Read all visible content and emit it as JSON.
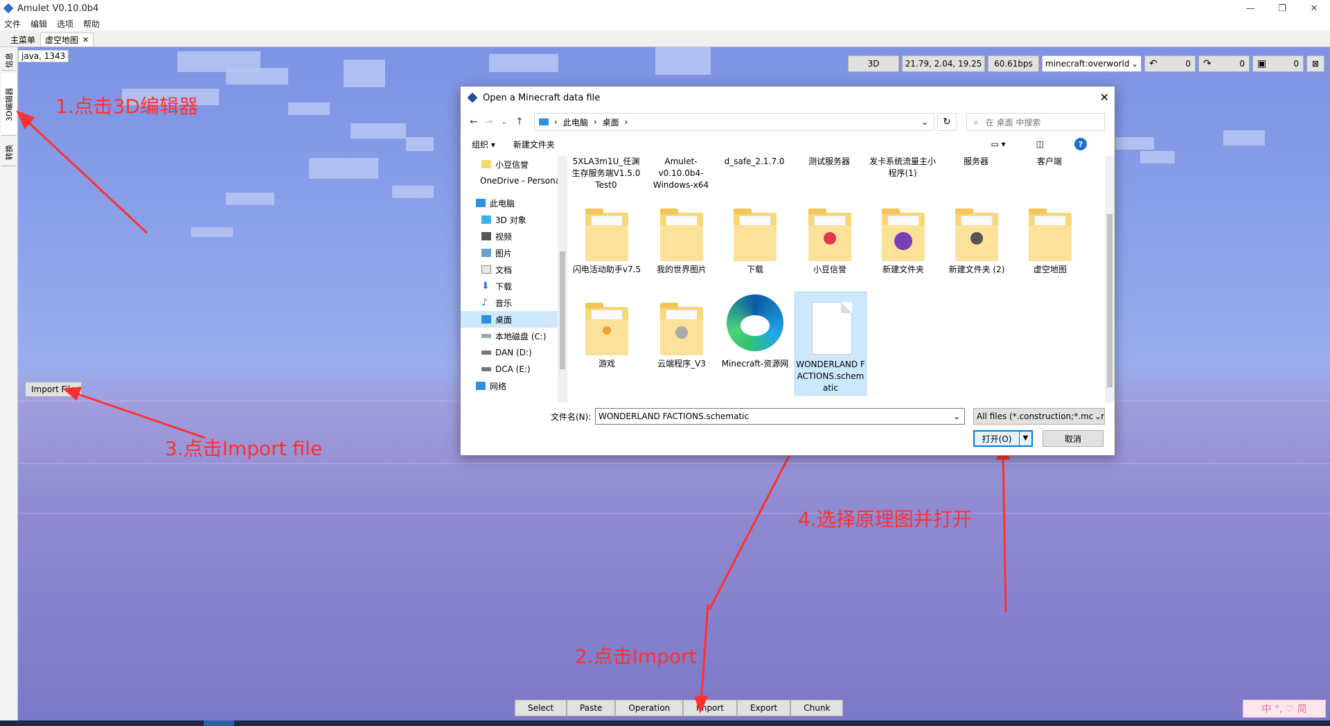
{
  "window": {
    "title": "Amulet V0.10.0b4",
    "minimize": "—",
    "maximize": "❐",
    "close": "✕"
  },
  "menubar": [
    "文件",
    "编辑",
    "选项",
    "帮助"
  ],
  "tabs": [
    {
      "label": "主菜单",
      "active": false
    },
    {
      "label": "虚空地图",
      "active": true,
      "close": "✕"
    }
  ],
  "sidebar": {
    "info": "信息",
    "editor3d": "3D编辑器",
    "convert": "转换"
  },
  "viewport": {
    "coord_label": "java, 1343",
    "toolbar": {
      "mode": "3D",
      "position": "21.79, 2.04, 19.25",
      "speed": "60.61bps",
      "dimension": "minecraft:overworld",
      "undo_count": "0",
      "redo_count": "0",
      "save_count": "0"
    },
    "import_file_label": "Import File",
    "bottom_buttons": [
      "Select",
      "Paste",
      "Operation",
      "Import",
      "Export",
      "Chunk"
    ]
  },
  "annotations": {
    "step1": "1.点击3D编辑器",
    "step2": "2.点击Import",
    "step3": "3.点击Import file",
    "step4": "4.选择原理图并打开"
  },
  "colors": {
    "annotation": "#ff3030",
    "accent": "#0078d7",
    "selection": "#cde8ff"
  },
  "dialog": {
    "title": "Open a Minecraft data file",
    "breadcrumb": [
      "此电脑",
      "桌面"
    ],
    "search_placeholder": "在 桌面 中搜索",
    "organize": "组织 ▾",
    "new_folder": "新建文件夹",
    "nav_items": [
      {
        "label": "小豆信誉",
        "icon": "folder-icon",
        "indent": 1
      },
      {
        "label": "OneDrive - Personal",
        "icon": "cloud-icon",
        "indent": 0
      },
      {
        "label": "此电脑",
        "icon": "computer-icon",
        "indent": 0
      },
      {
        "label": "3D 对象",
        "icon": "cube-icon",
        "indent": 1
      },
      {
        "label": "视频",
        "icon": "video-icon",
        "indent": 1
      },
      {
        "label": "图片",
        "icon": "picture-icon",
        "indent": 1
      },
      {
        "label": "文档",
        "icon": "document-icon",
        "indent": 1
      },
      {
        "label": "下载",
        "icon": "download-icon",
        "indent": 1
      },
      {
        "label": "音乐",
        "icon": "music-icon",
        "indent": 1
      },
      {
        "label": "桌面",
        "icon": "desktop-icon",
        "indent": 1,
        "selected": true
      },
      {
        "label": "本地磁盘 (C:)",
        "icon": "drive-icon",
        "indent": 1
      },
      {
        "label": "DAN (D:)",
        "icon": "drive-icon",
        "indent": 1
      },
      {
        "label": "DCA (E:)",
        "icon": "drive-icon",
        "indent": 1
      },
      {
        "label": "网络",
        "icon": "network-icon",
        "indent": 0
      }
    ],
    "top_row": [
      "5XLA3m1U_任渊生存服务端V1.5.0 Test0",
      "Amulet-v0.10.0b4-Windows-x64",
      "d_safe_2.1.7.0",
      "测试服务器",
      "发卡系统流量主小程序(1)",
      "服务器",
      "客户端"
    ],
    "row2": [
      "闪电活动助手v7.5",
      "我的世界图片",
      "下载",
      "小豆信誉",
      "新建文件夹",
      "新建文件夹 (2)",
      "虚空地图"
    ],
    "row3": [
      "游戏",
      "云端程序_V3",
      "Minecraft-资源网",
      "WONDERLAND FACTIONS.schematic"
    ],
    "selected_file": "WONDERLAND FACTIONS.schematic",
    "filename_label": "文件名(N):",
    "filename_value": "WONDERLAND FACTIONS.schematic",
    "filter": "All files (*.construction;*.mcstructure;*.schematic)",
    "open": "打开(O)",
    "cancel": "取消"
  },
  "ime": "中 °, ♡ 简"
}
